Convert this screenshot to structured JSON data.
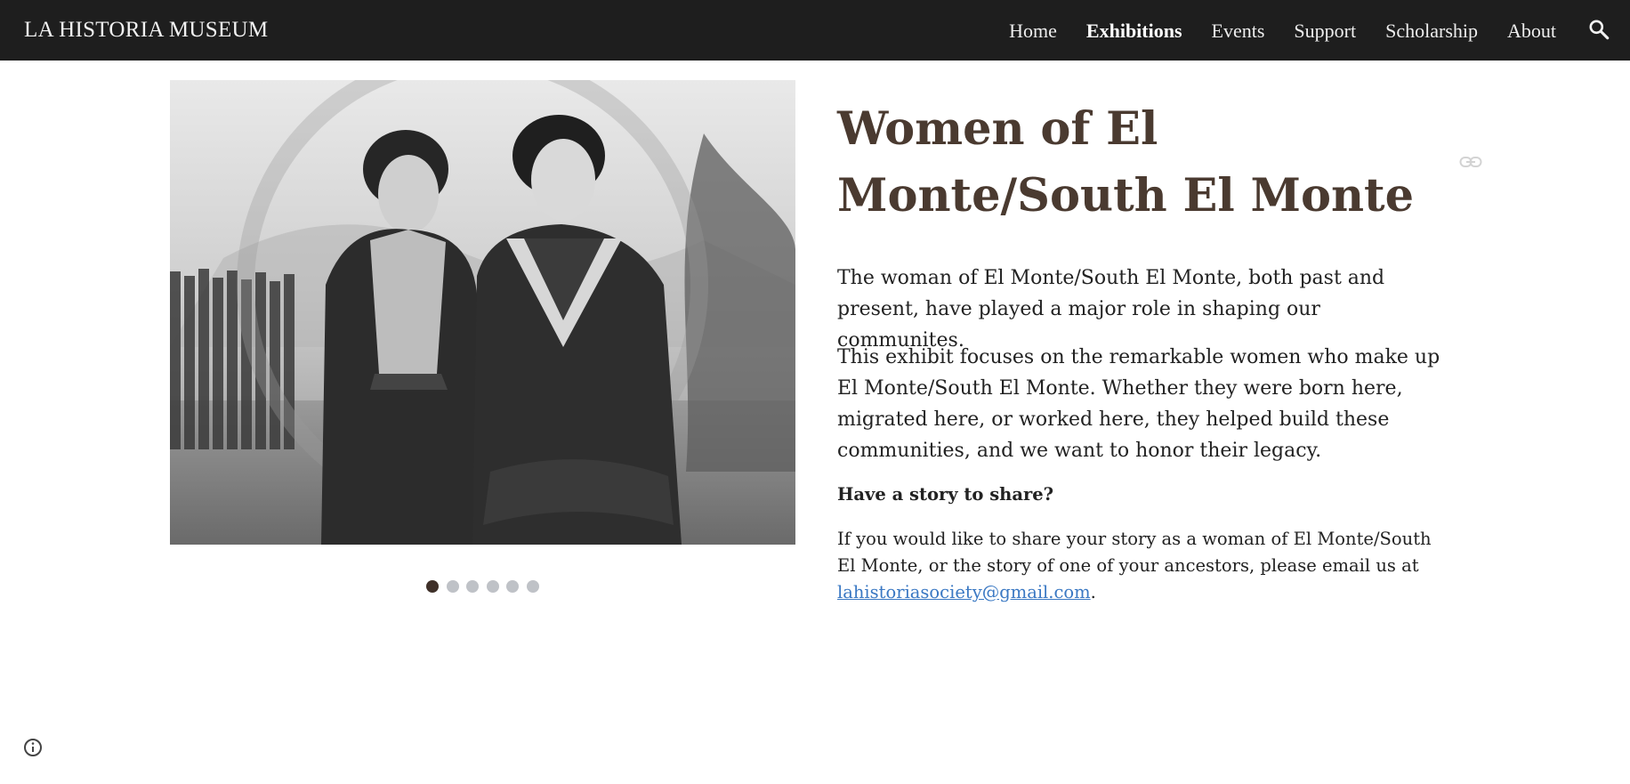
{
  "header": {
    "site_title": "LA HISTORIA MUSEUM",
    "nav": [
      {
        "label": "Home",
        "active": false
      },
      {
        "label": "Exhibitions",
        "active": true
      },
      {
        "label": "Events",
        "active": false
      },
      {
        "label": "Support",
        "active": false
      },
      {
        "label": "Scholarship",
        "active": false
      },
      {
        "label": "About",
        "active": false
      }
    ],
    "search_icon": "search-icon",
    "colors": {
      "bar": "#1e1e1e",
      "text": "#eeeeee"
    }
  },
  "carousel": {
    "image_icon": "photograph-two-women",
    "slide_count": 6,
    "active_index": 0,
    "colors": {
      "active": "#3f3029",
      "inactive": "#bfc2c7"
    }
  },
  "main": {
    "title": "Women of El Monte/South El Monte",
    "paragraph1": "The woman of El Monte/South El Monte, both past and present, have played a major role in shaping our communites.",
    "paragraph2": "This exhibit focuses on the remarkable women who make up El Monte/South El Monte. Whether they were born here, migrated here, or worked here, they helped build these communities, and we want to honor their legacy.",
    "subheading": "Have a story to share?",
    "paragraph3_text": "If you would like to share your story as a woman of El Monte/South El Monte, or the story of one of your ancestors, please email us at ",
    "email_link": "lahistoriasociety@gmail.com",
    "paragraph3_end": ".",
    "link_icon": "link-icon",
    "colors": {
      "title": "#4a3a30",
      "link": "#3a78c3"
    }
  },
  "footer": {
    "info_icon": "info-icon"
  }
}
